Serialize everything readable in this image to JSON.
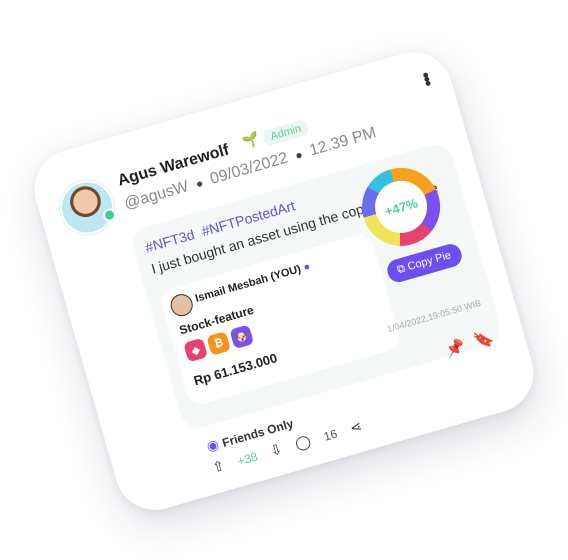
{
  "post": {
    "author_name": "Agus Warewolf",
    "role_badge": "Admin",
    "handle": "@agusW",
    "date": "09/03/2022",
    "time": "12.39 PM",
    "hashtags": [
      "#NFT3d",
      "#NFTPostedArt"
    ],
    "caption": "I just bought an asset using the copy pie feature"
  },
  "asset": {
    "owner": "Ismail Mesbah (YOU)",
    "feature_label": "Stock-feature",
    "coins": [
      {
        "symbol": "◆",
        "color": "#e8416f"
      },
      {
        "symbol": "₿",
        "color": "#f7931a"
      },
      {
        "symbol": "🐶",
        "color": "#7c4ff0"
      }
    ],
    "price": "Rp 61.153.000",
    "pie_change": "+47%",
    "copy_label": "Copy Pie",
    "timestamp": "1/04/2022,19:05:50 WIB"
  },
  "footer": {
    "visibility": "Friends Only",
    "upvotes": "+38",
    "comments": "16"
  },
  "icons": [
    "sprout-icon",
    "verified-icon",
    "more-icon",
    "eye-icon",
    "upvote-icon",
    "downvote-icon",
    "comment-icon",
    "share-icon",
    "pin-icon",
    "bookmark-icon",
    "copy-icon"
  ],
  "colors": {
    "accent": "#6c4ef2",
    "positive": "#4fd1a8",
    "badge_bg": "#e8f7ef"
  }
}
